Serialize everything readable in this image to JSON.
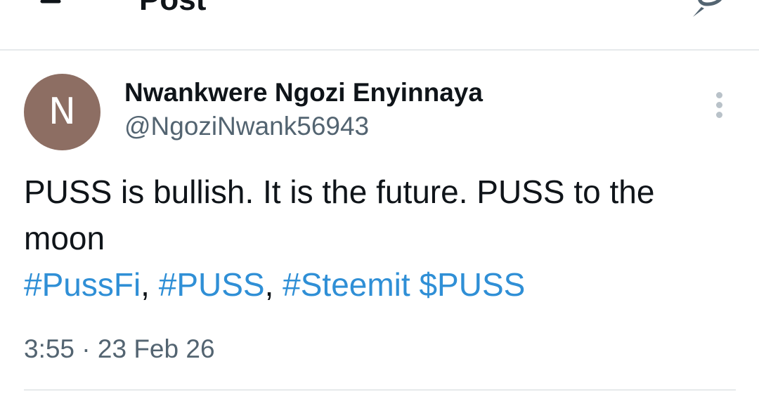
{
  "header": {
    "title": "Post",
    "back_icon": "arrow-left-icon",
    "reply_icon": "reply-icon"
  },
  "post": {
    "avatar_initial": "N",
    "avatar_color": "#8d6e63",
    "display_name": "Nwankwere Ngozi Enyinnaya",
    "handle": "@NgoziNwank56943",
    "text_line1": "PUSS is bullish. It is the future. PUSS to the",
    "text_line2": "moon",
    "tags": {
      "tag1": "#PussFi",
      "sep1": ", ",
      "tag2": "#PUSS",
      "sep2": ", ",
      "tag3": "#Steemit",
      "sep3": " ",
      "tag4": "$PUSS"
    },
    "timestamp": "3:55 · 23 Feb 26"
  },
  "colors": {
    "link": "#2f8fd6",
    "secondary_text": "#536471",
    "primary_text": "#0f1419"
  }
}
